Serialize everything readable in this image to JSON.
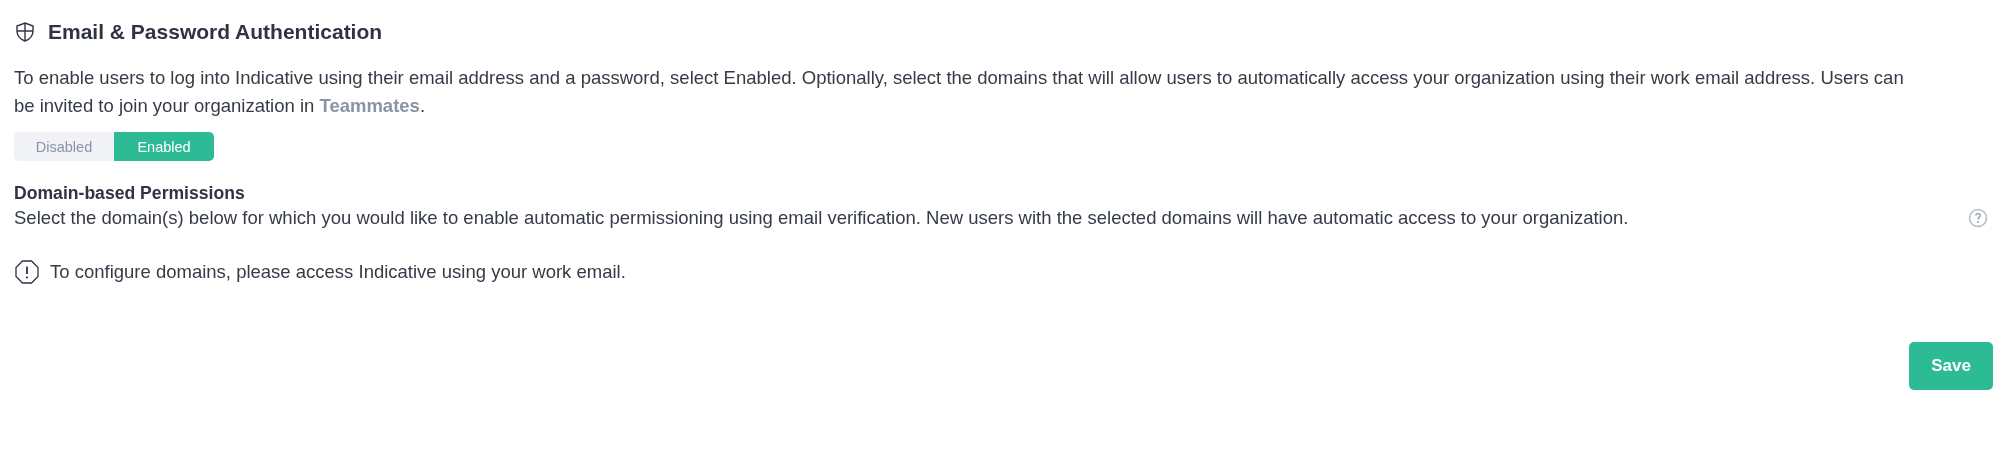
{
  "section": {
    "title": "Email & Password Authentication",
    "description": {
      "text": "To enable users to log into Indicative using their email address and a password, select Enabled. Optionally, select the domains that will allow users to automatically access your organization using their work email address. Users can be invited to join your organization in ",
      "link": "Teammates",
      "after": "."
    },
    "toggle": [
      {
        "label": "Disabled",
        "selected": false
      },
      {
        "label": "Enabled",
        "selected": true
      }
    ]
  },
  "domains": {
    "title": "Domain-based Permissions",
    "description": "Select the domain(s) below for which you would like to enable automatic permissioning using email verification. New users with the selected domains will have automatic access to your organization.",
    "notice": "To configure domains, please access Indicative using your work email."
  },
  "buttons": [
    {
      "label": "Save"
    }
  ]
}
